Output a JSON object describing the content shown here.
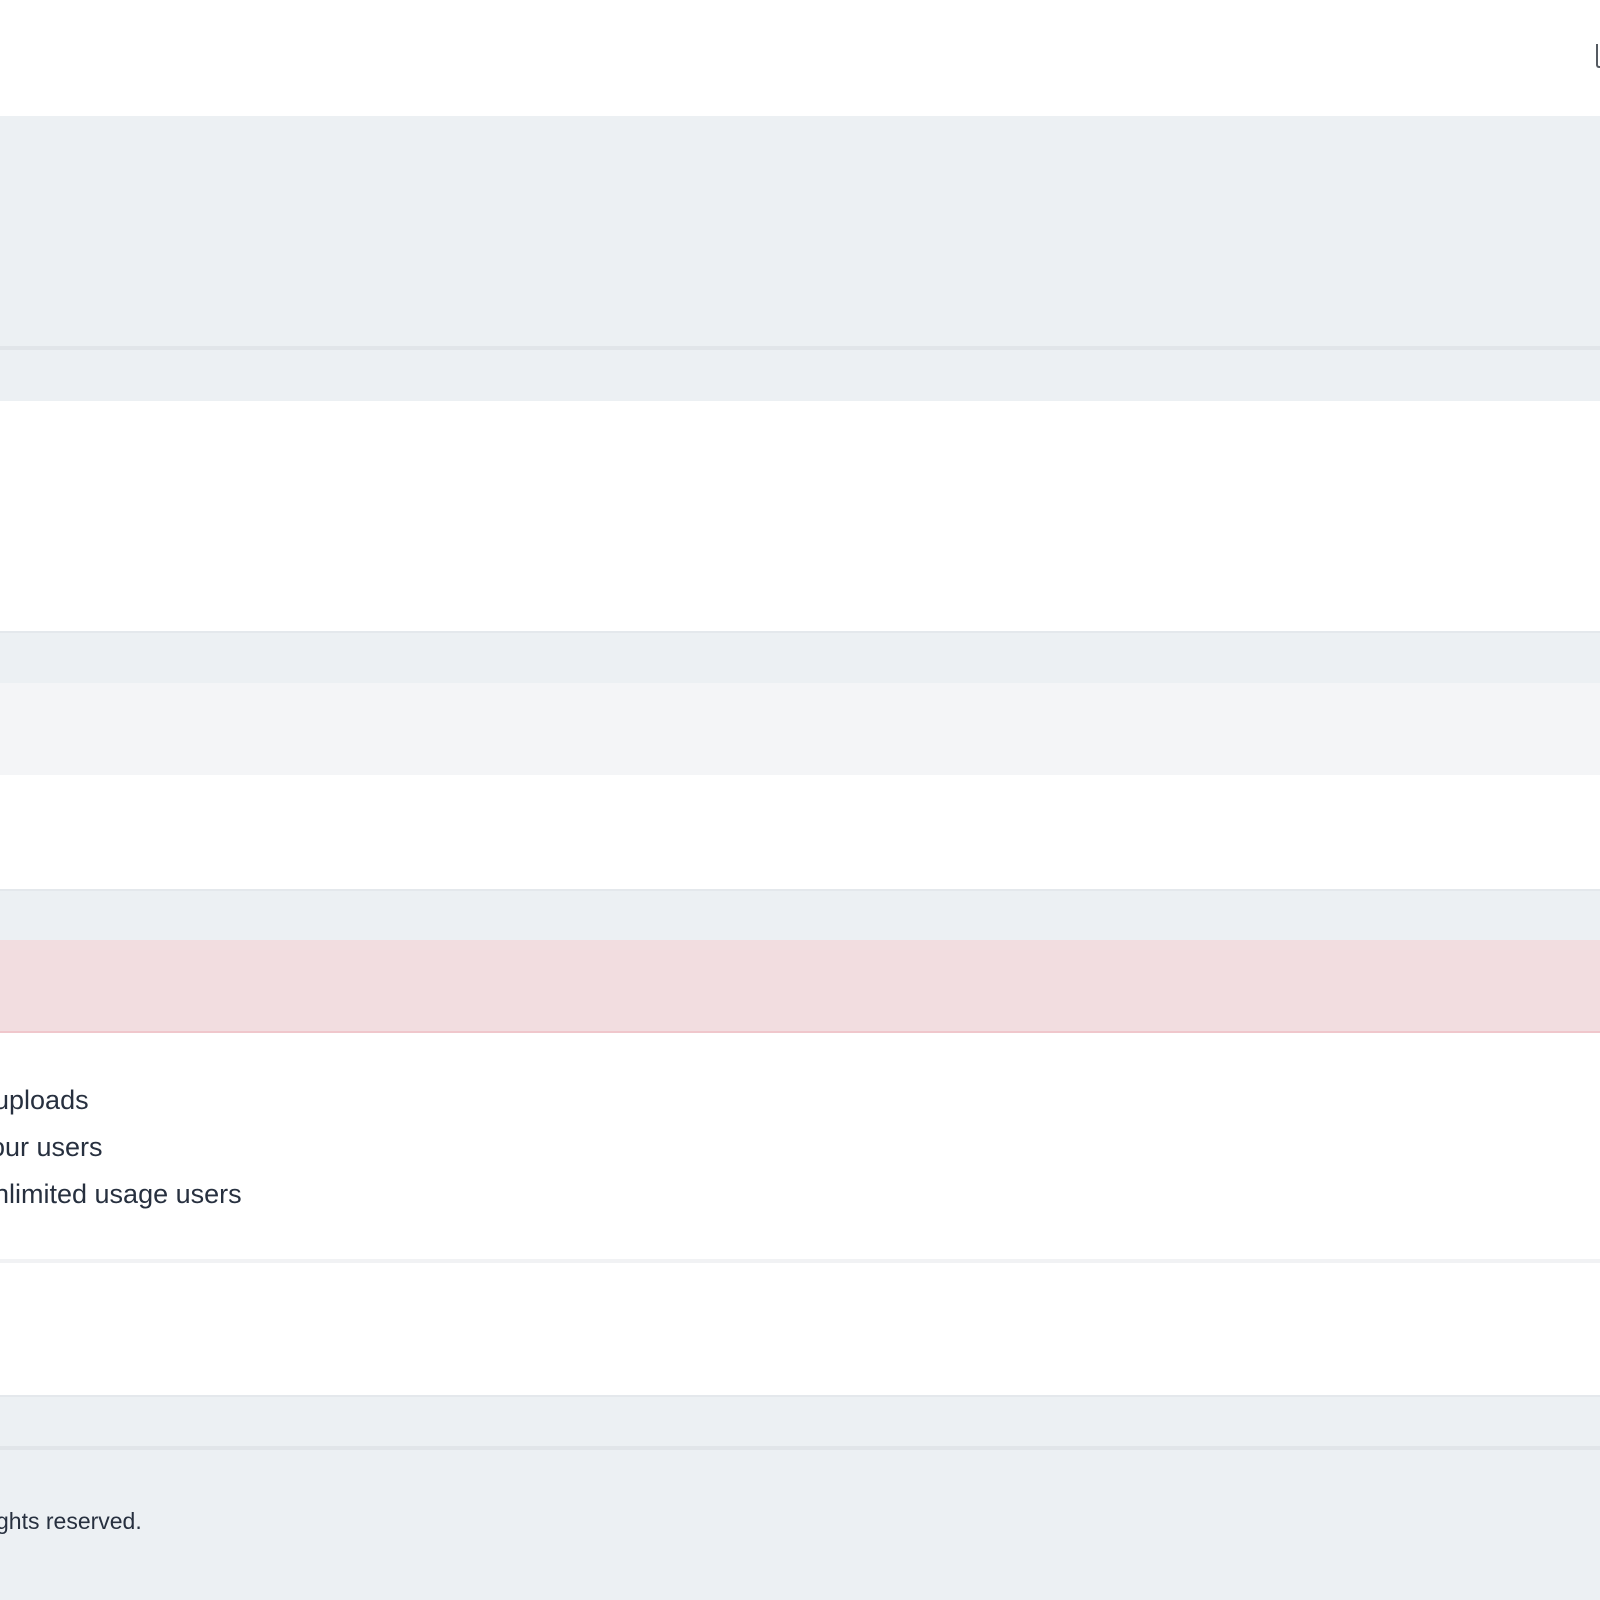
{
  "features": {
    "items": [
      {
        "label": "uploads"
      },
      {
        "label": "our users"
      },
      {
        "label": "nlimited usage users"
      }
    ]
  },
  "footer": {
    "copyright": "ghts reserved."
  },
  "colors": {
    "page_background": "#ecf0f3",
    "card_background": "#ffffff",
    "alert_background": "#f2dde0",
    "text": "#27303f"
  }
}
